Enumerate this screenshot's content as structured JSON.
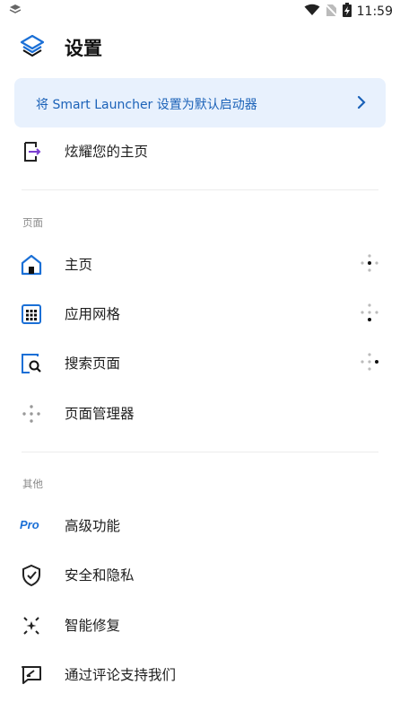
{
  "status": {
    "time": "11:59"
  },
  "header": {
    "title": "设置"
  },
  "banner": {
    "text": "将 Smart Launcher 设置为默认启动器"
  },
  "top_item": {
    "label": "炫耀您的主页"
  },
  "sections": {
    "pages": {
      "title": "页面",
      "items": [
        {
          "label": "主页"
        },
        {
          "label": "应用网格"
        },
        {
          "label": "搜索页面"
        },
        {
          "label": "页面管理器"
        }
      ]
    },
    "other": {
      "title": "其他",
      "items": [
        {
          "label": "高级功能",
          "icon_text": "Pro"
        },
        {
          "label": "安全和隐私"
        },
        {
          "label": "智能修复"
        },
        {
          "label": "通过评论支持我们"
        }
      ]
    }
  },
  "colors": {
    "accent": "#1b62b8",
    "banner_bg": "#e8f1fd",
    "icon_blue": "#1a6fd6"
  }
}
